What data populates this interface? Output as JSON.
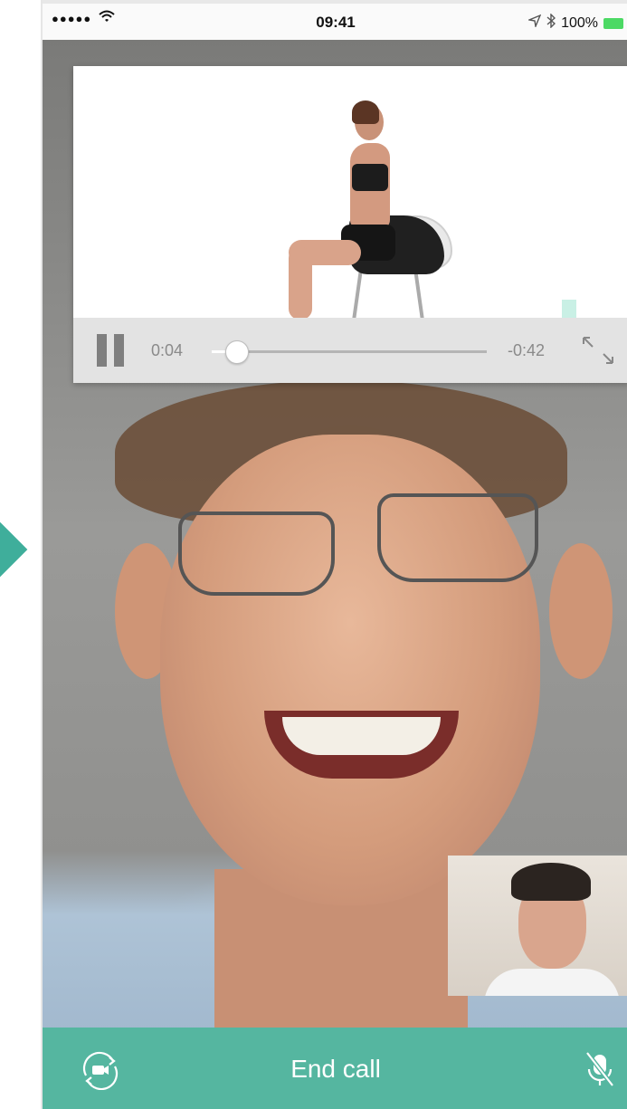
{
  "status_bar": {
    "signal": "●●●●●",
    "time": "09:41",
    "battery": "100%"
  },
  "media_player": {
    "elapsed": "0:04",
    "remaining": "-0:42",
    "progress_fraction": 0.09,
    "state": "playing",
    "icons": [
      "pause-icon",
      "fullscreen-icon"
    ]
  },
  "call": {
    "end_call_label": "End call",
    "icons": [
      "switch-camera-icon",
      "mute-microphone-icon"
    ],
    "accent_color": "#55b6a0"
  }
}
